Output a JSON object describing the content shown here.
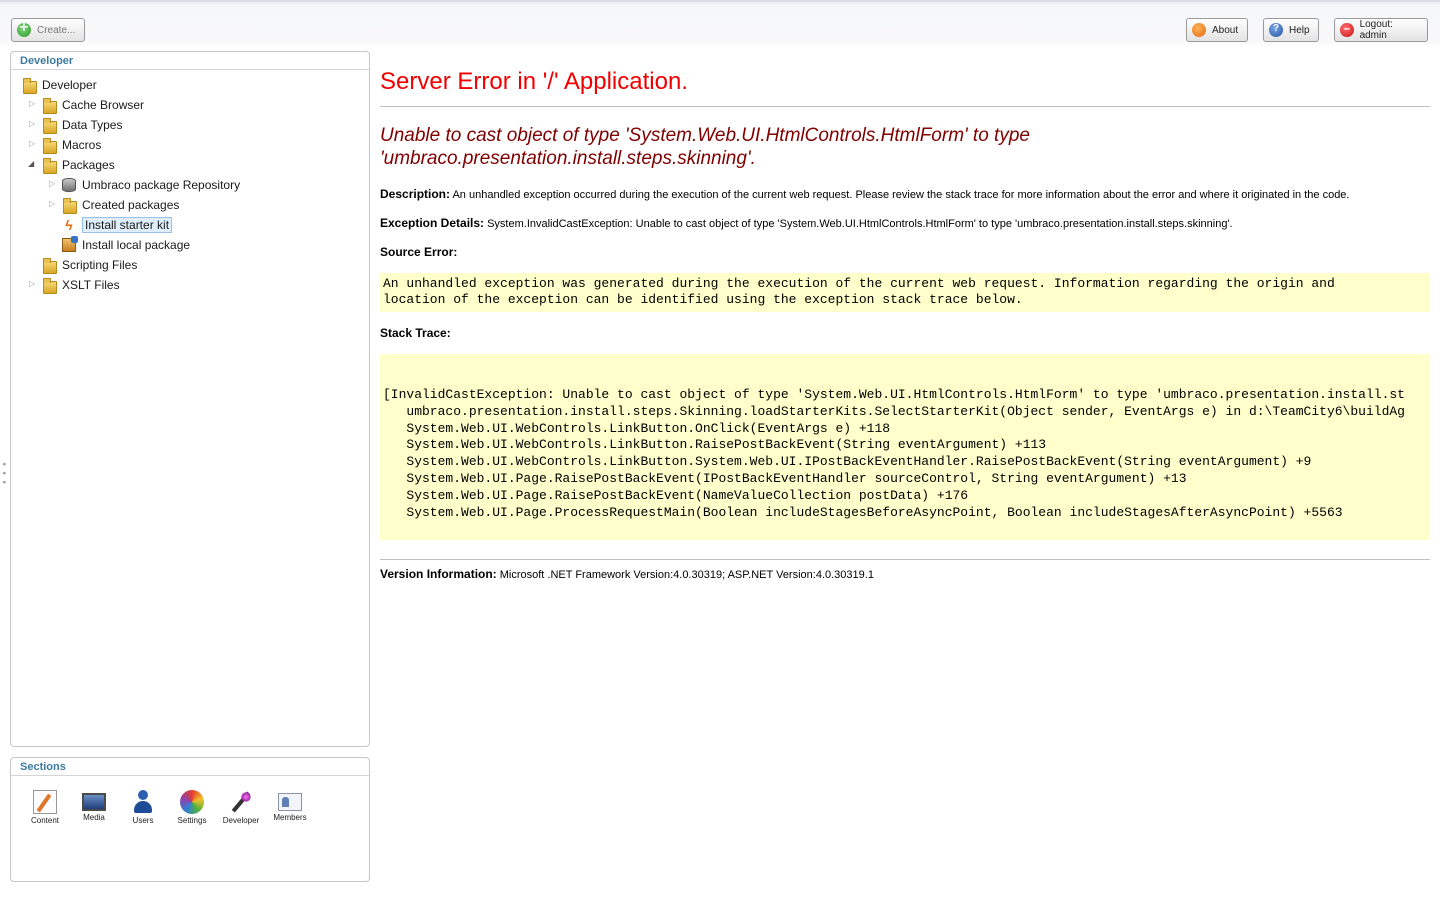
{
  "toolbar": {
    "create_label": "Create...",
    "about_label": "About",
    "help_label": "Help",
    "logout_label": "Logout: admin"
  },
  "tree": {
    "header": "Developer",
    "root": "Developer",
    "items": {
      "cache_browser": "Cache Browser",
      "data_types": "Data Types",
      "macros": "Macros",
      "packages": "Packages",
      "umbraco_repo": "Umbraco package Repository",
      "created_packages": "Created packages",
      "install_starter_kit": "Install starter kit",
      "install_local_package": "Install local package",
      "scripting_files": "Scripting Files",
      "xslt_files": "XSLT Files"
    },
    "selected": "Install starter kit"
  },
  "sections": {
    "header": "Sections",
    "items": [
      "Content",
      "Media",
      "Users",
      "Settings",
      "Developer",
      "Members"
    ]
  },
  "error": {
    "title": "Server Error in '/' Application.",
    "message_line1": "Unable to cast object of type 'System.Web.UI.HtmlControls.HtmlForm' to type",
    "message_line2": "'umbraco.presentation.install.steps.skinning'.",
    "description_label": "Description:",
    "description_text": " An unhandled exception occurred during the execution of the current web request. Please review the stack trace for more information about the error and where it originated in the code.",
    "exception_label": "Exception Details:",
    "exception_text": " System.InvalidCastException: Unable to cast object of type 'System.Web.UI.HtmlControls.HtmlForm' to type 'umbraco.presentation.install.steps.skinning'.",
    "source_label": "Source Error:",
    "source_line1": "An unhandled exception was generated during the execution of the current web request. Information regarding the origin and",
    "source_line2": "location of the exception can be identified using the exception stack trace below.",
    "stack_label": "Stack Trace:",
    "stack_lines": [
      "[InvalidCastException: Unable to cast object of type 'System.Web.UI.HtmlControls.HtmlForm' to type 'umbraco.presentation.install.st",
      "   umbraco.presentation.install.steps.Skinning.loadStarterKits.SelectStarterKit(Object sender, EventArgs e) in d:\\TeamCity6\\buildAg",
      "   System.Web.UI.WebControls.LinkButton.OnClick(EventArgs e) +118",
      "   System.Web.UI.WebControls.LinkButton.RaisePostBackEvent(String eventArgument) +113",
      "   System.Web.UI.WebControls.LinkButton.System.Web.UI.IPostBackEventHandler.RaisePostBackEvent(String eventArgument) +9",
      "   System.Web.UI.Page.RaisePostBackEvent(IPostBackEventHandler sourceControl, String eventArgument) +13",
      "   System.Web.UI.Page.RaisePostBackEvent(NameValueCollection postData) +176",
      "   System.Web.UI.Page.ProcessRequestMain(Boolean includeStagesBeforeAsyncPoint, Boolean includeStagesAfterAsyncPoint) +5563"
    ],
    "version_label": "Version Information:",
    "version_text": " Microsoft .NET Framework Version:4.0.30319; ASP.NET Version:4.0.30319.1"
  }
}
